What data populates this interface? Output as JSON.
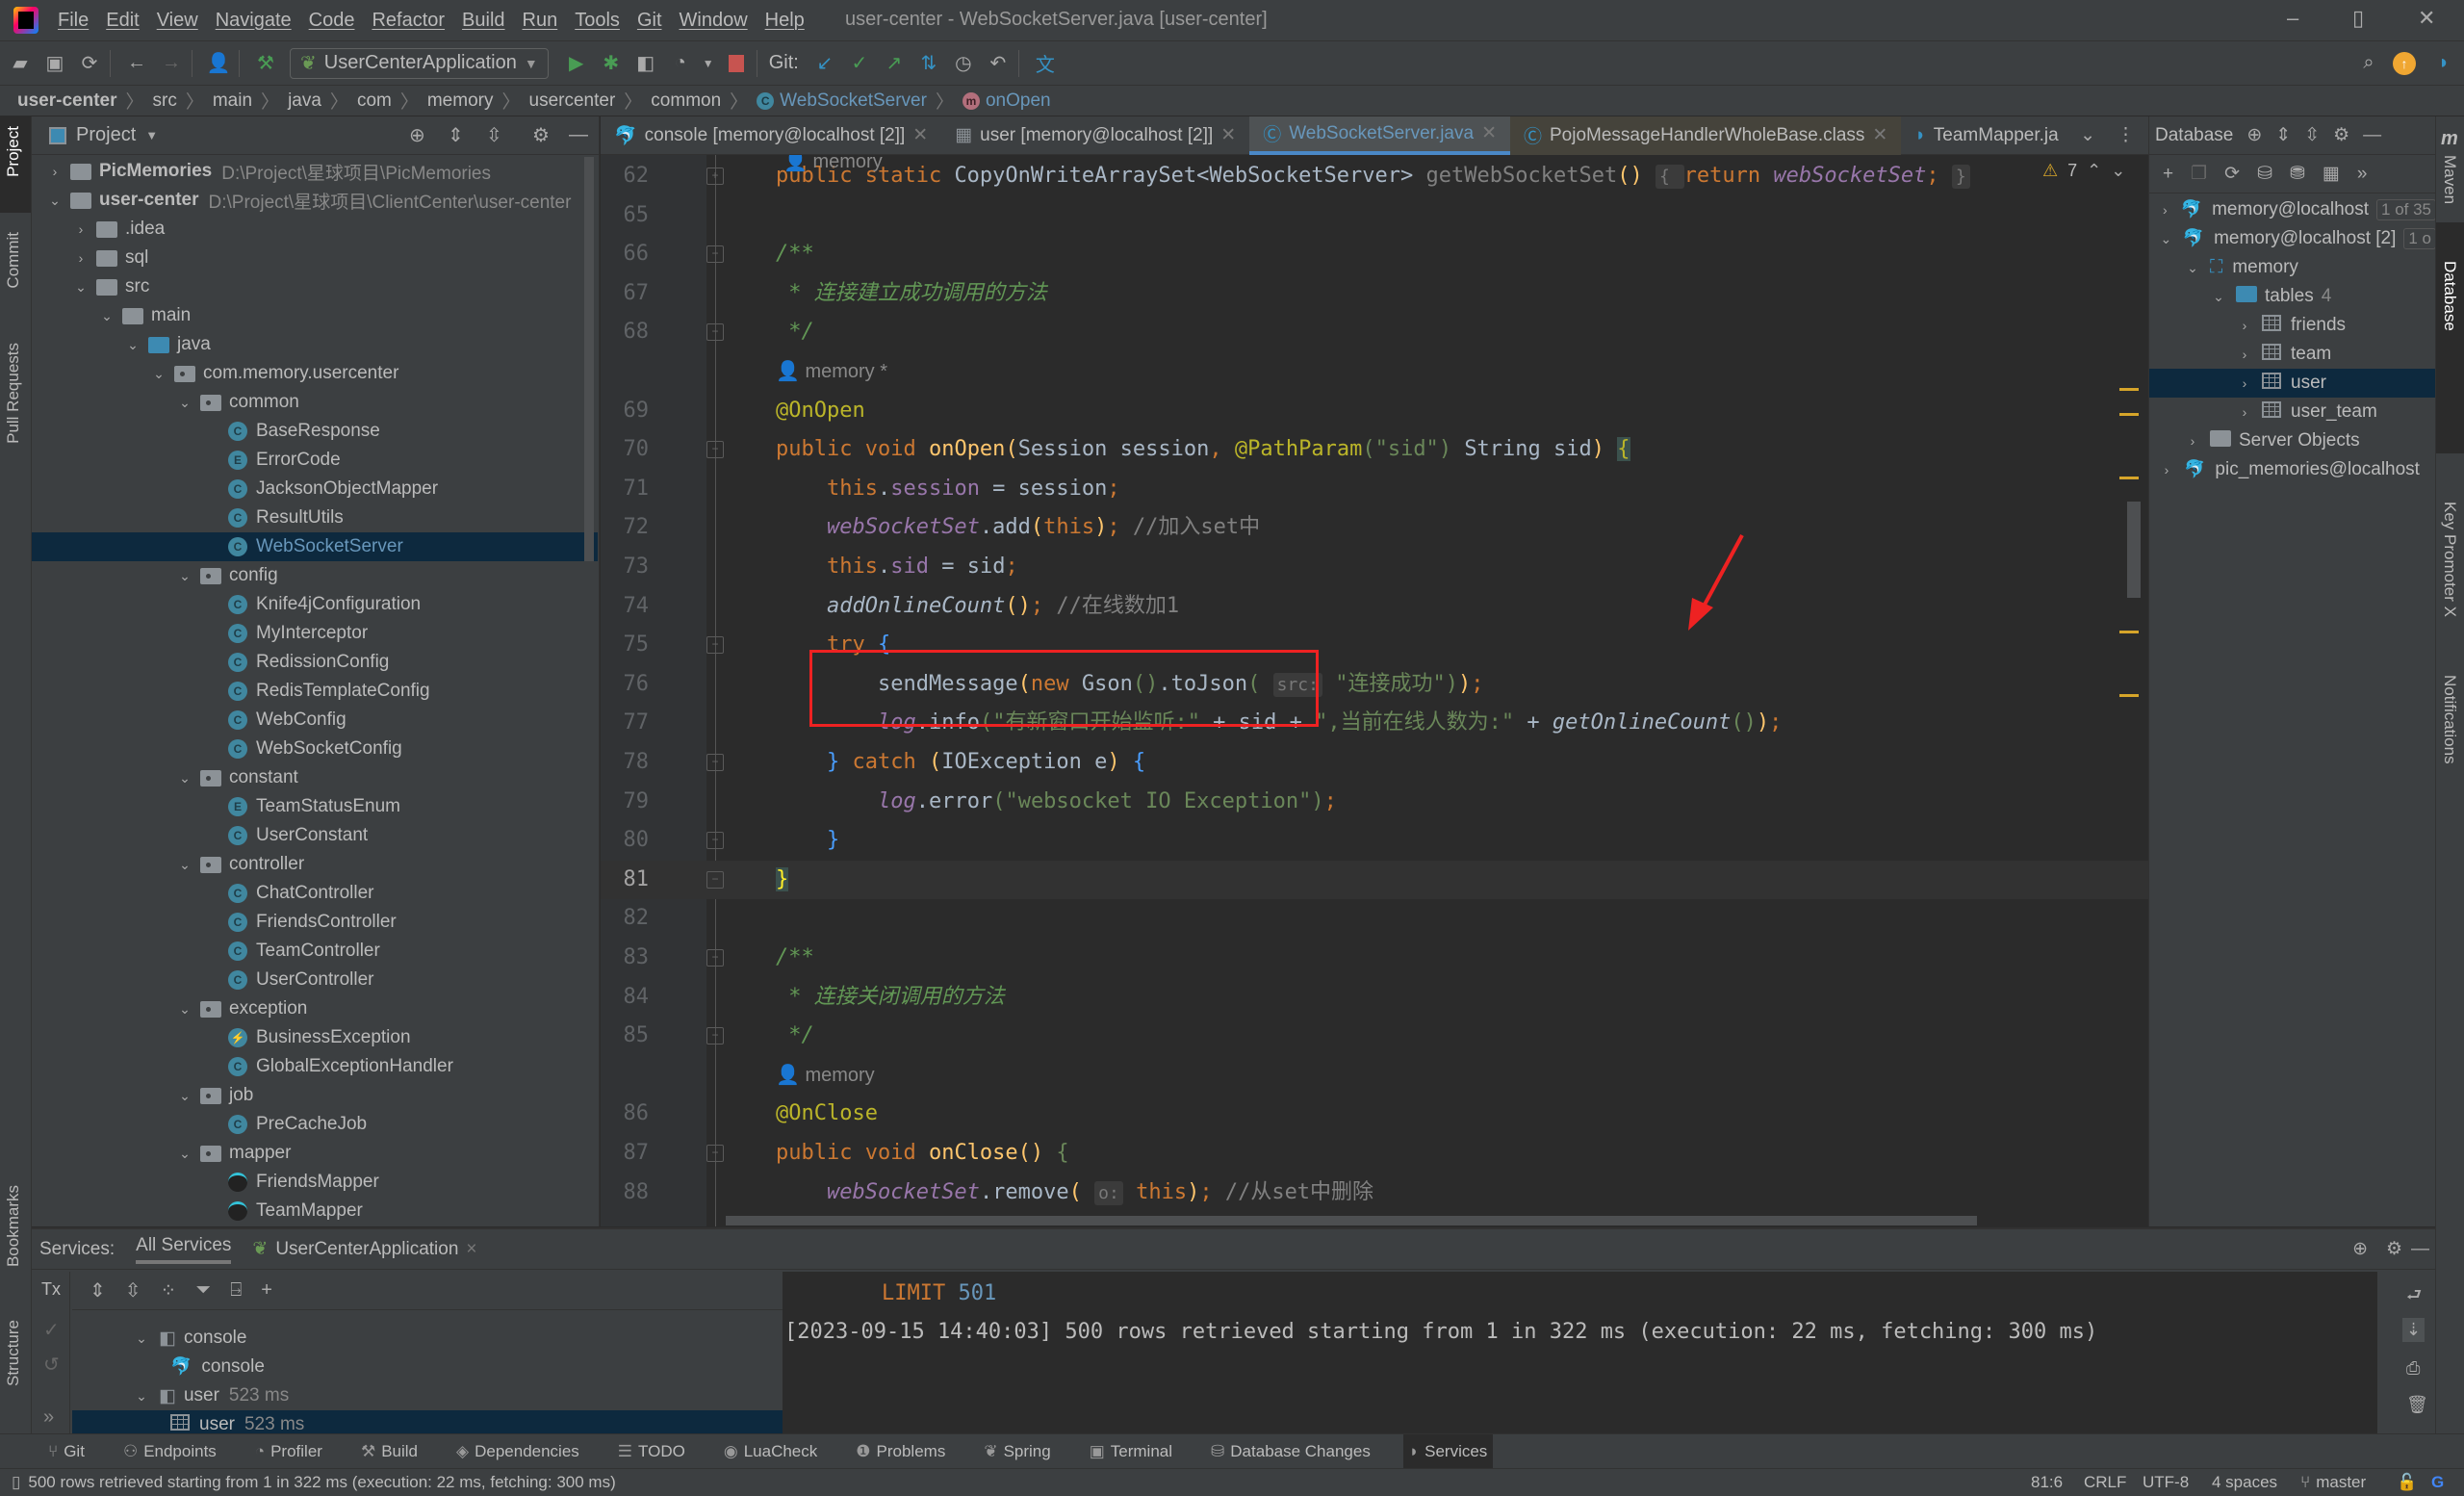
{
  "window": {
    "title": "user-center - WebSocketServer.java [user-center]",
    "menu": [
      "File",
      "Edit",
      "View",
      "Navigate",
      "Code",
      "Refactor",
      "Build",
      "Run",
      "Tools",
      "Git",
      "Window",
      "Help"
    ],
    "controls": {
      "minimize": "–",
      "restore": "▯",
      "close": "✕"
    }
  },
  "toolbar": {
    "run_config": "UserCenterApplication",
    "git_label": "Git:",
    "icons": [
      "open-folder-icon",
      "save-icon",
      "sync-icon",
      "back-icon",
      "forward-icon",
      "user-icon",
      "build-hammer-icon",
      "run-icon",
      "debug-icon",
      "coverage-icon",
      "profile-icon",
      "stop-icon",
      "git-update-icon",
      "git-commit-icon",
      "git-push-icon",
      "git-compare-icon",
      "history-icon",
      "rollback-icon",
      "translate-icon",
      "search-icon",
      "update-icon",
      "toolbox-icon"
    ]
  },
  "breadcrumb": [
    "user-center",
    "src",
    "main",
    "java",
    "com",
    "memory",
    "usercenter",
    "common",
    "WebSocketServer",
    "onOpen"
  ],
  "left_strip": [
    "Project",
    "Commit",
    "Pull Requests",
    "Bookmarks",
    "Structure"
  ],
  "project": {
    "title": "Project",
    "tree": [
      {
        "label": "PicMemories",
        "path": "D:\\Project\\星球项目\\PicMemories",
        "depth": 0,
        "type": "module",
        "expanded": false
      },
      {
        "label": "user-center",
        "path": "D:\\Project\\星球项目\\ClientCenter\\user-center",
        "depth": 0,
        "type": "module",
        "expanded": true
      },
      {
        "label": ".idea",
        "depth": 1,
        "type": "folder",
        "expanded": false
      },
      {
        "label": "sql",
        "depth": 1,
        "type": "folder",
        "expanded": false
      },
      {
        "label": "src",
        "depth": 1,
        "type": "folder",
        "expanded": true
      },
      {
        "label": "main",
        "depth": 2,
        "type": "folder",
        "expanded": true
      },
      {
        "label": "java",
        "depth": 3,
        "type": "srcfolder",
        "expanded": true
      },
      {
        "label": "com.memory.usercenter",
        "depth": 4,
        "type": "package",
        "expanded": true
      },
      {
        "label": "common",
        "depth": 5,
        "type": "package",
        "expanded": true
      },
      {
        "label": "BaseResponse",
        "depth": 6,
        "type": "class",
        "badge": "C"
      },
      {
        "label": "ErrorCode",
        "depth": 6,
        "type": "enum",
        "badge": "E"
      },
      {
        "label": "JacksonObjectMapper",
        "depth": 6,
        "type": "class",
        "badge": "C"
      },
      {
        "label": "ResultUtils",
        "depth": 6,
        "type": "class",
        "badge": "C"
      },
      {
        "label": "WebSocketServer",
        "depth": 6,
        "type": "class",
        "badge": "C",
        "selected": true
      },
      {
        "label": "config",
        "depth": 5,
        "type": "package",
        "expanded": true
      },
      {
        "label": "Knife4jConfiguration",
        "depth": 6,
        "type": "class",
        "badge": "C"
      },
      {
        "label": "MyInterceptor",
        "depth": 6,
        "type": "class",
        "badge": "C"
      },
      {
        "label": "RedissionConfig",
        "depth": 6,
        "type": "class",
        "badge": "C"
      },
      {
        "label": "RedisTemplateConfig",
        "depth": 6,
        "type": "class",
        "badge": "C"
      },
      {
        "label": "WebConfig",
        "depth": 6,
        "type": "class",
        "badge": "C"
      },
      {
        "label": "WebSocketConfig",
        "depth": 6,
        "type": "class",
        "badge": "C"
      },
      {
        "label": "constant",
        "depth": 5,
        "type": "package",
        "expanded": true
      },
      {
        "label": "TeamStatusEnum",
        "depth": 6,
        "type": "enum",
        "badge": "E"
      },
      {
        "label": "UserConstant",
        "depth": 6,
        "type": "class",
        "badge": "C"
      },
      {
        "label": "controller",
        "depth": 5,
        "type": "package",
        "expanded": true
      },
      {
        "label": "ChatController",
        "depth": 6,
        "type": "class",
        "badge": "C"
      },
      {
        "label": "FriendsController",
        "depth": 6,
        "type": "class",
        "badge": "C"
      },
      {
        "label": "TeamController",
        "depth": 6,
        "type": "class",
        "badge": "C"
      },
      {
        "label": "UserController",
        "depth": 6,
        "type": "class",
        "badge": "C"
      },
      {
        "label": "exception",
        "depth": 5,
        "type": "package",
        "expanded": true
      },
      {
        "label": "BusinessException",
        "depth": 6,
        "type": "exception",
        "badge": "⚡"
      },
      {
        "label": "GlobalExceptionHandler",
        "depth": 6,
        "type": "class",
        "badge": "C"
      },
      {
        "label": "job",
        "depth": 5,
        "type": "package",
        "expanded": true
      },
      {
        "label": "PreCacheJob",
        "depth": 6,
        "type": "class",
        "badge": "C"
      },
      {
        "label": "mapper",
        "depth": 5,
        "type": "package",
        "expanded": true
      },
      {
        "label": "FriendsMapper",
        "depth": 6,
        "type": "mapper"
      },
      {
        "label": "TeamMapper",
        "depth": 6,
        "type": "mapper"
      }
    ]
  },
  "editor_tabs": [
    {
      "label": "console [memory@localhost [2]]",
      "icon": "mysql-icon",
      "closable": true
    },
    {
      "label": "user [memory@localhost [2]]",
      "icon": "table-icon",
      "closable": true
    },
    {
      "label": "WebSocketServer.java",
      "icon": "class-icon",
      "closable": true,
      "active": true
    },
    {
      "label": "PojoMessageHandlerWholeBase.class",
      "icon": "class-icon",
      "closable": true
    },
    {
      "label": "TeamMapper.ja",
      "icon": "mapper-icon",
      "closable": false
    }
  ],
  "editor": {
    "warnings_count": "7",
    "author_top": "memory",
    "lines": [
      {
        "n": "62",
        "html": "<span class='k'>public static </span><span class='t'>CopyOnWriteArraySet</span><span class='t'>&lt;WebSocketServer&gt; </span><span class='c'>getWebSocketSet</span><span class='fn'>()</span> <span class='hint'>{ </span><span class='k'>return </span><span class='st'>webSocketSet</span><span class='k'>;</span> <span class='hint'>}</span>"
      },
      {
        "n": "65",
        "html": ""
      },
      {
        "n": "66",
        "html": "<span class='cm'>/**</span>"
      },
      {
        "n": "67",
        "html": "<span class='cm'> * 连接建立成功调用的方法</span>"
      },
      {
        "n": "68",
        "html": "<span class='cm'> */</span>"
      },
      {
        "n": "",
        "html": "<span class='author'>👤 memory *</span>"
      },
      {
        "n": "69",
        "html": "<span class='an'>@OnOpen</span>"
      },
      {
        "n": "70",
        "html": "<span class='k'>public void </span><span class='fn'>onOpen</span><span class='fn'>(</span><span class='t'>Session session</span><span class='k'>, </span><span class='an'>@PathParam</span><span class='s'>(</span><span class='s'>\"sid\"</span><span class='s'>)</span> <span class='t'>String sid</span><span class='fn'>)</span> <span class='an' style='background:#3b514d'>{</span>"
      },
      {
        "n": "71",
        "html": "    <span class='k'>this</span><span class='t'>.</span><span class='st' style='font-style:normal'>session</span><span class='t'> = session</span><span class='k'>;</span>"
      },
      {
        "n": "72",
        "html": "    <span class='st'>webSocketSet</span><span class='t'>.add</span><span class='fn'>(</span><span class='k'>this</span><span class='fn'>)</span><span class='k'>;</span> <span class='c'>//加入set中</span>"
      },
      {
        "n": "73",
        "html": "    <span class='k'>this</span><span class='t'>.</span><span class='st' style='font-style:normal'>sid</span><span class='t'> = sid</span><span class='k'>;</span>"
      },
      {
        "n": "74",
        "html": "    <span class='t it'>addOnlineCount</span><span class='fn'>()</span><span class='k'>;</span> <span class='c'>//在线数加1</span>"
      },
      {
        "n": "75",
        "html": "    <span class='k'>try </span><span style='color:#4a9eff'>{</span>"
      },
      {
        "n": "76",
        "html": "        <span class='t'>sendMessage</span><span class='fn'>(</span><span class='k'>new </span><span class='t'>Gson</span><span class='s'>()</span><span class='t'>.toJson</span><span class='s'>(</span> <span class='hint'>src:</span> <span class='s'>\"连接成功\"</span><span class='s'>)</span><span class='fn'>)</span><span class='k'>;</span>"
      },
      {
        "n": "77",
        "html": "        <span class='st'>log</span><span class='t'>.info</span><span class='s'>(\"有新窗口开始监听:\"</span><span class='t'> + sid + </span><span class='s'>\",当前在线人数为:\"</span><span class='t'> + </span><span class='t it'>getOnlineCount</span><span class='s'>()</span><span class='fn'>)</span><span class='k'>;</span>"
      },
      {
        "n": "78",
        "html": "    <span style='color:#4a9eff'>}</span> <span class='k'>catch </span><span class='fn'>(</span><span class='t'>IOException e</span><span class='fn'>)</span> <span style='color:#4a9eff'>{</span>"
      },
      {
        "n": "79",
        "html": "        <span class='st'>log</span><span class='t'>.error</span><span class='s'>(\"websocket IO Exception\")</span><span class='k'>;</span>"
      },
      {
        "n": "80",
        "html": "    <span style='color:#4a9eff'>}</span>"
      },
      {
        "n": "81",
        "html": "<span class='an' style='background:#3b514d;color:#ffef28'>}</span>",
        "current": true
      },
      {
        "n": "82",
        "html": ""
      },
      {
        "n": "83",
        "html": "<span class='cm'>/**</span>"
      },
      {
        "n": "84",
        "html": "<span class='cm'> * 连接关闭调用的方法</span>"
      },
      {
        "n": "85",
        "html": "<span class='cm'> */</span>"
      },
      {
        "n": "",
        "html": "<span class='author'>👤 memory</span>"
      },
      {
        "n": "86",
        "html": "<span class='an'>@OnClose</span>"
      },
      {
        "n": "87",
        "html": "<span class='k'>public void </span><span class='fn'>onClose</span><span class='fn'>()</span> <span class='s'>{</span>"
      },
      {
        "n": "88",
        "html": "    <span class='st'>webSocketSet</span><span class='t'>.remove</span><span class='fn'>(</span> <span class='hint'>o:</span> <span class='k'>this</span><span class='fn'>)</span><span class='k'>;</span> <span class='c'>//从set中删除</span>"
      }
    ]
  },
  "database": {
    "title": "Database",
    "tree": [
      {
        "label": "memory@localhost",
        "badge": "1 of 35",
        "depth": 0,
        "icon": "mysql-icon",
        "expanded": false
      },
      {
        "label": "memory@localhost [2]",
        "badge": "1 o",
        "depth": 0,
        "icon": "mysql-icon",
        "expanded": true
      },
      {
        "label": "memory",
        "depth": 1,
        "icon": "schema-icon",
        "expanded": true
      },
      {
        "label": "tables",
        "count": "4",
        "depth": 2,
        "icon": "folder-icon",
        "expanded": true
      },
      {
        "label": "friends",
        "depth": 3,
        "icon": "table-icon",
        "expanded": false
      },
      {
        "label": "team",
        "depth": 3,
        "icon": "table-icon",
        "expanded": false
      },
      {
        "label": "user",
        "depth": 3,
        "icon": "table-icon",
        "expanded": false,
        "selected": true
      },
      {
        "label": "user_team",
        "depth": 3,
        "icon": "table-icon",
        "expanded": false
      },
      {
        "label": "Server Objects",
        "depth": 1,
        "icon": "server-objects-icon",
        "expanded": false
      },
      {
        "label": "pic_memories@localhost",
        "depth": 0,
        "icon": "mysql-icon",
        "expanded": false
      }
    ]
  },
  "right_strip": [
    "Maven",
    "Database",
    "Key Promoter X",
    "Notifications"
  ],
  "services": {
    "label": "Services:",
    "tabs": [
      {
        "label": "All Services",
        "active": true
      },
      {
        "label": "UserCenterApplication",
        "closable": true
      }
    ],
    "tx_label": "Tx",
    "tree": [
      {
        "label": "console",
        "depth": 0,
        "icon": "session-icon",
        "expanded": true
      },
      {
        "label": "console",
        "depth": 1,
        "icon": "mysql-icon"
      },
      {
        "label": "user",
        "time": "523 ms",
        "depth": 0,
        "icon": "session-icon",
        "expanded": true
      },
      {
        "label": "user",
        "time": "523 ms",
        "depth": 1,
        "icon": "table-icon",
        "selected": true
      }
    ],
    "console": {
      "sql_keyword": "LIMIT",
      "sql_value": "501",
      "log_line": "[2023-09-15 14:40:03] 500 rows retrieved starting from 1 in 322 ms (execution: 22 ms, fetching: 300 ms)"
    }
  },
  "bottom_tools": [
    "Git",
    "Endpoints",
    "Profiler",
    "Build",
    "Dependencies",
    "TODO",
    "LuaCheck",
    "Problems",
    "Spring",
    "Terminal",
    "Database Changes",
    "Services"
  ],
  "status": {
    "message": "500 rows retrieved starting from 1 in 322 ms (execution: 22 ms, fetching: 300 ms)",
    "position": "81:6",
    "line_sep": "CRLF",
    "encoding": "UTF-8",
    "indent": "4 spaces",
    "branch": "master"
  }
}
